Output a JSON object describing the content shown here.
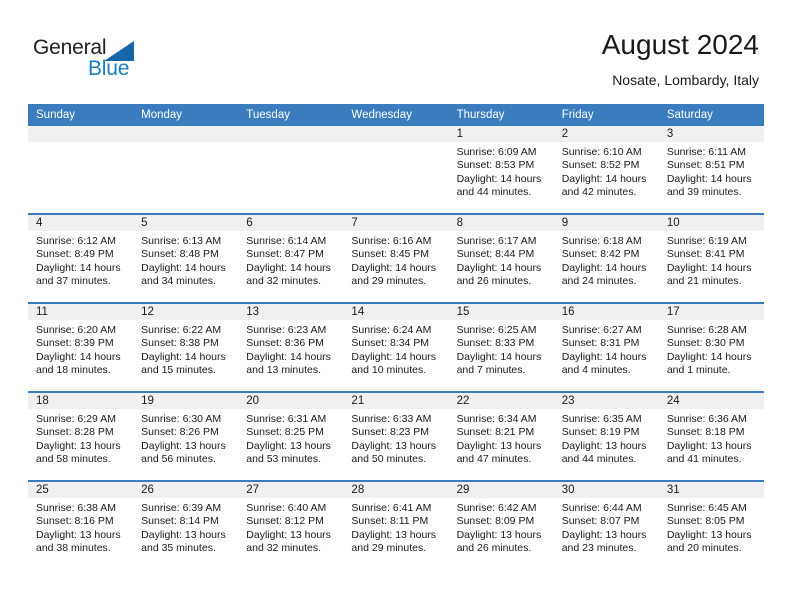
{
  "brand": {
    "name_part1": "General",
    "name_part2": "Blue",
    "accent_color": "#1d7dc4",
    "triangle_color": "#1565a8"
  },
  "header": {
    "title": "August 2024",
    "subtitle": "Nosate, Lombardy, Italy",
    "header_bg": "#3a7cbd",
    "daynum_band_bg": "#f0f0f0"
  },
  "weekdays": [
    "Sunday",
    "Monday",
    "Tuesday",
    "Wednesday",
    "Thursday",
    "Friday",
    "Saturday"
  ],
  "weeks": [
    [
      {
        "day": "",
        "empty": true
      },
      {
        "day": "",
        "empty": true
      },
      {
        "day": "",
        "empty": true
      },
      {
        "day": "",
        "empty": true
      },
      {
        "day": "1",
        "sunrise": "Sunrise: 6:09 AM",
        "sunset": "Sunset: 8:53 PM",
        "daylight_line1": "Daylight: 14 hours",
        "daylight_line2": "and 44 minutes."
      },
      {
        "day": "2",
        "sunrise": "Sunrise: 6:10 AM",
        "sunset": "Sunset: 8:52 PM",
        "daylight_line1": "Daylight: 14 hours",
        "daylight_line2": "and 42 minutes."
      },
      {
        "day": "3",
        "sunrise": "Sunrise: 6:11 AM",
        "sunset": "Sunset: 8:51 PM",
        "daylight_line1": "Daylight: 14 hours",
        "daylight_line2": "and 39 minutes."
      }
    ],
    [
      {
        "day": "4",
        "sunrise": "Sunrise: 6:12 AM",
        "sunset": "Sunset: 8:49 PM",
        "daylight_line1": "Daylight: 14 hours",
        "daylight_line2": "and 37 minutes."
      },
      {
        "day": "5",
        "sunrise": "Sunrise: 6:13 AM",
        "sunset": "Sunset: 8:48 PM",
        "daylight_line1": "Daylight: 14 hours",
        "daylight_line2": "and 34 minutes."
      },
      {
        "day": "6",
        "sunrise": "Sunrise: 6:14 AM",
        "sunset": "Sunset: 8:47 PM",
        "daylight_line1": "Daylight: 14 hours",
        "daylight_line2": "and 32 minutes."
      },
      {
        "day": "7",
        "sunrise": "Sunrise: 6:16 AM",
        "sunset": "Sunset: 8:45 PM",
        "daylight_line1": "Daylight: 14 hours",
        "daylight_line2": "and 29 minutes."
      },
      {
        "day": "8",
        "sunrise": "Sunrise: 6:17 AM",
        "sunset": "Sunset: 8:44 PM",
        "daylight_line1": "Daylight: 14 hours",
        "daylight_line2": "and 26 minutes."
      },
      {
        "day": "9",
        "sunrise": "Sunrise: 6:18 AM",
        "sunset": "Sunset: 8:42 PM",
        "daylight_line1": "Daylight: 14 hours",
        "daylight_line2": "and 24 minutes."
      },
      {
        "day": "10",
        "sunrise": "Sunrise: 6:19 AM",
        "sunset": "Sunset: 8:41 PM",
        "daylight_line1": "Daylight: 14 hours",
        "daylight_line2": "and 21 minutes."
      }
    ],
    [
      {
        "day": "11",
        "sunrise": "Sunrise: 6:20 AM",
        "sunset": "Sunset: 8:39 PM",
        "daylight_line1": "Daylight: 14 hours",
        "daylight_line2": "and 18 minutes."
      },
      {
        "day": "12",
        "sunrise": "Sunrise: 6:22 AM",
        "sunset": "Sunset: 8:38 PM",
        "daylight_line1": "Daylight: 14 hours",
        "daylight_line2": "and 15 minutes."
      },
      {
        "day": "13",
        "sunrise": "Sunrise: 6:23 AM",
        "sunset": "Sunset: 8:36 PM",
        "daylight_line1": "Daylight: 14 hours",
        "daylight_line2": "and 13 minutes."
      },
      {
        "day": "14",
        "sunrise": "Sunrise: 6:24 AM",
        "sunset": "Sunset: 8:34 PM",
        "daylight_line1": "Daylight: 14 hours",
        "daylight_line2": "and 10 minutes."
      },
      {
        "day": "15",
        "sunrise": "Sunrise: 6:25 AM",
        "sunset": "Sunset: 8:33 PM",
        "daylight_line1": "Daylight: 14 hours",
        "daylight_line2": "and 7 minutes."
      },
      {
        "day": "16",
        "sunrise": "Sunrise: 6:27 AM",
        "sunset": "Sunset: 8:31 PM",
        "daylight_line1": "Daylight: 14 hours",
        "daylight_line2": "and 4 minutes."
      },
      {
        "day": "17",
        "sunrise": "Sunrise: 6:28 AM",
        "sunset": "Sunset: 8:30 PM",
        "daylight_line1": "Daylight: 14 hours",
        "daylight_line2": "and 1 minute."
      }
    ],
    [
      {
        "day": "18",
        "sunrise": "Sunrise: 6:29 AM",
        "sunset": "Sunset: 8:28 PM",
        "daylight_line1": "Daylight: 13 hours",
        "daylight_line2": "and 58 minutes."
      },
      {
        "day": "19",
        "sunrise": "Sunrise: 6:30 AM",
        "sunset": "Sunset: 8:26 PM",
        "daylight_line1": "Daylight: 13 hours",
        "daylight_line2": "and 56 minutes."
      },
      {
        "day": "20",
        "sunrise": "Sunrise: 6:31 AM",
        "sunset": "Sunset: 8:25 PM",
        "daylight_line1": "Daylight: 13 hours",
        "daylight_line2": "and 53 minutes."
      },
      {
        "day": "21",
        "sunrise": "Sunrise: 6:33 AM",
        "sunset": "Sunset: 8:23 PM",
        "daylight_line1": "Daylight: 13 hours",
        "daylight_line2": "and 50 minutes."
      },
      {
        "day": "22",
        "sunrise": "Sunrise: 6:34 AM",
        "sunset": "Sunset: 8:21 PM",
        "daylight_line1": "Daylight: 13 hours",
        "daylight_line2": "and 47 minutes."
      },
      {
        "day": "23",
        "sunrise": "Sunrise: 6:35 AM",
        "sunset": "Sunset: 8:19 PM",
        "daylight_line1": "Daylight: 13 hours",
        "daylight_line2": "and 44 minutes."
      },
      {
        "day": "24",
        "sunrise": "Sunrise: 6:36 AM",
        "sunset": "Sunset: 8:18 PM",
        "daylight_line1": "Daylight: 13 hours",
        "daylight_line2": "and 41 minutes."
      }
    ],
    [
      {
        "day": "25",
        "sunrise": "Sunrise: 6:38 AM",
        "sunset": "Sunset: 8:16 PM",
        "daylight_line1": "Daylight: 13 hours",
        "daylight_line2": "and 38 minutes."
      },
      {
        "day": "26",
        "sunrise": "Sunrise: 6:39 AM",
        "sunset": "Sunset: 8:14 PM",
        "daylight_line1": "Daylight: 13 hours",
        "daylight_line2": "and 35 minutes."
      },
      {
        "day": "27",
        "sunrise": "Sunrise: 6:40 AM",
        "sunset": "Sunset: 8:12 PM",
        "daylight_line1": "Daylight: 13 hours",
        "daylight_line2": "and 32 minutes."
      },
      {
        "day": "28",
        "sunrise": "Sunrise: 6:41 AM",
        "sunset": "Sunset: 8:11 PM",
        "daylight_line1": "Daylight: 13 hours",
        "daylight_line2": "and 29 minutes."
      },
      {
        "day": "29",
        "sunrise": "Sunrise: 6:42 AM",
        "sunset": "Sunset: 8:09 PM",
        "daylight_line1": "Daylight: 13 hours",
        "daylight_line2": "and 26 minutes."
      },
      {
        "day": "30",
        "sunrise": "Sunrise: 6:44 AM",
        "sunset": "Sunset: 8:07 PM",
        "daylight_line1": "Daylight: 13 hours",
        "daylight_line2": "and 23 minutes."
      },
      {
        "day": "31",
        "sunrise": "Sunrise: 6:45 AM",
        "sunset": "Sunset: 8:05 PM",
        "daylight_line1": "Daylight: 13 hours",
        "daylight_line2": "and 20 minutes."
      }
    ]
  ]
}
